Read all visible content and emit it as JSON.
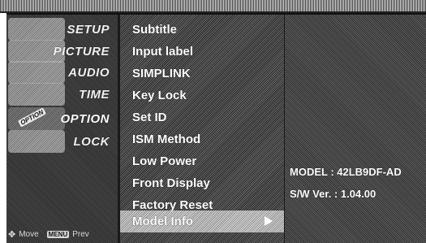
{
  "sidebar": {
    "items": [
      {
        "label": "SETUP",
        "icon": "setup-icon"
      },
      {
        "label": "PICTURE",
        "icon": "picture-icon"
      },
      {
        "label": "AUDIO",
        "icon": "audio-icon"
      },
      {
        "label": "TIME",
        "icon": "time-icon"
      },
      {
        "label": "OPTION",
        "icon": "option-icon",
        "active": true,
        "tag": "OPTION"
      },
      {
        "label": "LOCK",
        "icon": "lock-icon"
      }
    ],
    "help": {
      "move_icon": "✥",
      "move_label": "Move",
      "menu_key": "MENU",
      "prev_label": "Prev"
    }
  },
  "menu": {
    "items": [
      {
        "label": "Subtitle"
      },
      {
        "label": "Input label"
      },
      {
        "label": "SIMPLINK"
      },
      {
        "label": "Key Lock"
      },
      {
        "label": "Set ID"
      },
      {
        "label": "ISM Method"
      },
      {
        "label": "Low Power"
      },
      {
        "label": "Front Display"
      },
      {
        "label": "Factory Reset"
      },
      {
        "label": "Model Info",
        "selected": true
      }
    ]
  },
  "info": {
    "model": "MODEL : 42LB9DF-AD",
    "version": "S/W Ver. : 1.04.00"
  }
}
